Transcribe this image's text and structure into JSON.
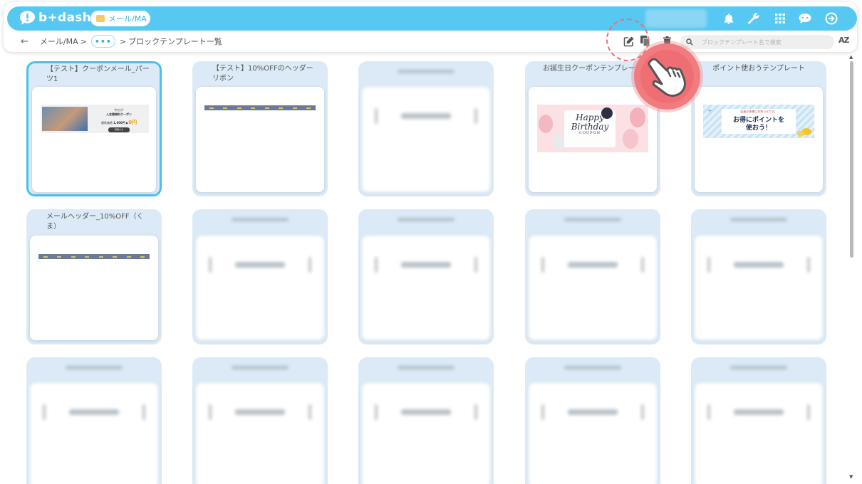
{
  "brand": {
    "name": "b+dash"
  },
  "header": {
    "section_pill": "メール/MA",
    "icons": [
      "bell-icon",
      "wrench-icon",
      "apps-grid-icon",
      "chat-bot-icon",
      "logout-icon"
    ]
  },
  "breadcrumb": {
    "back": "←",
    "root": "メール/MA",
    "sep1": ">",
    "more": "•••",
    "sep2": ">",
    "current": "ブロックテンプレート一覧"
  },
  "toolbar": {
    "search_placeholder": "ブロックテンプレート名で検索",
    "sort_label": "AZ"
  },
  "colors": {
    "accent": "#56c8f2",
    "card_bg": "#dbeaf6",
    "highlight": "#ef6e73"
  },
  "cards": [
    {
      "title": "【テスト】クーポンメール_パーツ1",
      "selected": true,
      "preview": "coupon-banner",
      "preview_text": {
        "headline": "今だけ!",
        "subtitle": "入会費無料クーポン",
        "price_label": "通常価格",
        "price": "1,000円 ▶",
        "zero": "0円",
        "button": "登録する"
      }
    },
    {
      "title": "【テスト】10%OFFのヘッダーリボン",
      "preview": "ribbon"
    },
    {
      "title": "",
      "preview": "blurred"
    },
    {
      "title": "お誕生日クーポンテンプレート",
      "preview": "birthday",
      "preview_text": {
        "line1": "Happy",
        "line2": "Birthday",
        "line3": "COUPON"
      }
    },
    {
      "title": "ポイント使おうテンプレート",
      "preview": "points",
      "preview_text": {
        "small": "会員の皆様にお知らせです。",
        "main1": "お得にポイントを",
        "main2": "使おう！"
      }
    },
    {
      "title": "メールヘッダー_10%OFF（くま）",
      "preview": "ribbon"
    },
    {
      "title": "",
      "preview": "blurred"
    },
    {
      "title": "",
      "preview": "blurred"
    },
    {
      "title": "",
      "preview": "blurred"
    },
    {
      "title": "",
      "preview": "blurred"
    },
    {
      "title": "",
      "preview": "blurred"
    },
    {
      "title": "",
      "preview": "blurred"
    },
    {
      "title": "",
      "preview": "blurred"
    },
    {
      "title": "",
      "preview": "blurred"
    },
    {
      "title": "",
      "preview": "blurred"
    }
  ]
}
